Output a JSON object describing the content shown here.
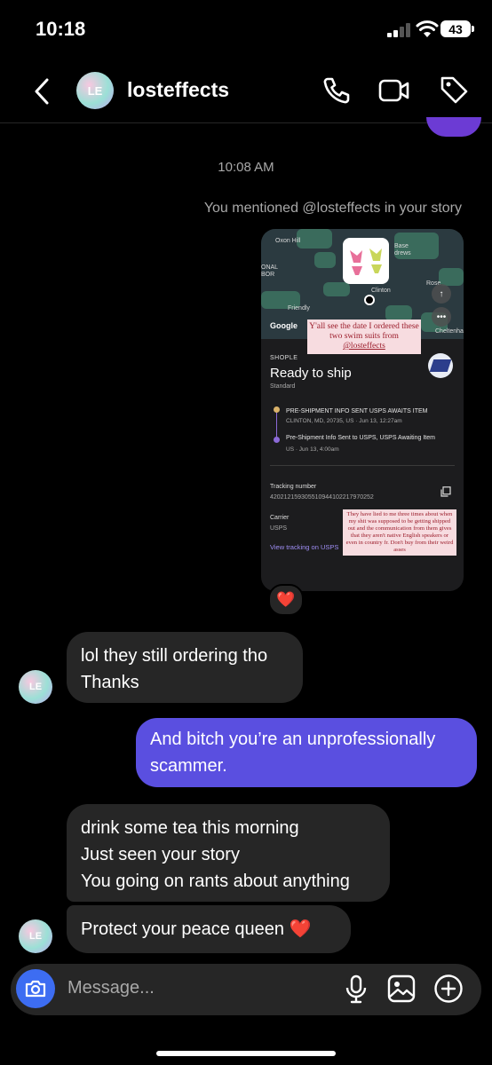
{
  "status_bar": {
    "time": "10:18",
    "battery": "43"
  },
  "header": {
    "username": "losteffects",
    "avatar_text": "LE"
  },
  "thread": {
    "timestamp": "10:08 AM",
    "mention": "You mentioned @losteffects in your story",
    "story": {
      "map_labels": [
        "Oxon Hill",
        "Base",
        "drews",
        "ONAL",
        "BOR",
        "Clinton",
        "Friendly",
        "Rose",
        "Cheltenha"
      ],
      "google": "Google",
      "note_top": "Y'all see the date I ordered these two swim suits from",
      "note_top_link": "@losteffects",
      "shop": "SHOPLE",
      "status": "Ready to ship",
      "service": "Standard",
      "event1_title": "PRE-SHIPMENT INFO SENT USPS AWAITS ITEM",
      "event1_sub": "CLINTON, MD, 20735, US · Jun 13, 12:27am",
      "event2_title": "Pre-Shipment Info Sent to USPS, USPS Awaiting Item",
      "event2_sub": "US · Jun 13, 4:00am",
      "tracking_label": "Tracking number",
      "tracking_number": "420212159305510944102217970252",
      "carrier_label": "Carrier",
      "carrier": "USPS",
      "view_tracking": "View tracking on USPS",
      "note_bottom": "They have lied to me three times about when my shit was supposed to be getting shipped out and the communication from them gives that they aren't native English speakers or even in country fr. Don't buy from their weird asses"
    },
    "reaction": "❤️",
    "messages": [
      {
        "from": "them",
        "text": "lol they still ordering tho\nThanks"
      },
      {
        "from": "me",
        "text": "And bitch you’re an unprofessionally\nscammer."
      },
      {
        "from": "them",
        "text": "drink some tea this morning\nJust seen your story\nYou going on rants about anything"
      },
      {
        "from": "them",
        "text": "Protect your peace queen ❤️"
      }
    ]
  },
  "composer": {
    "placeholder": "Message..."
  },
  "colors": {
    "outgoing": "#5a4fe0",
    "incoming": "#262626",
    "camera": "#3d6df2"
  }
}
